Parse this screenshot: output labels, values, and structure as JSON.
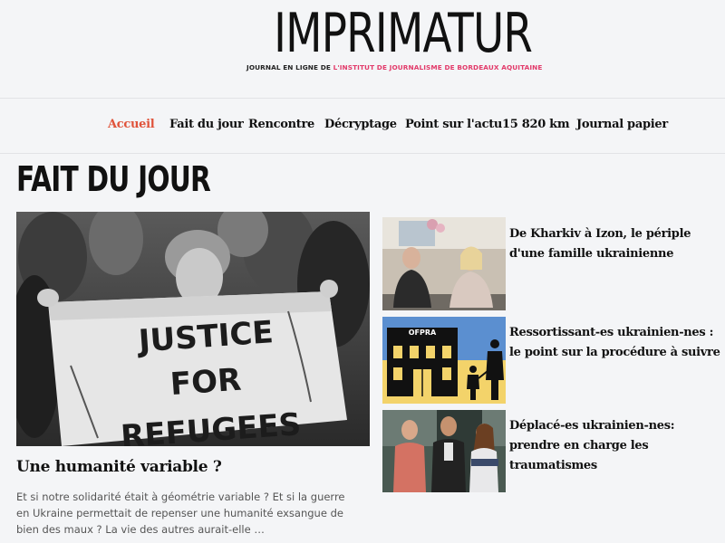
{
  "masthead": {
    "title": "IMPRIMATUR",
    "subtitle_prefix": "JOURNAL EN LIGNE DE ",
    "subtitle_highlight": "L'INSTITUT DE JOURNALISME DE BORDEAUX AQUITAINE"
  },
  "nav": {
    "items": [
      {
        "label": "Accueil",
        "active": true
      },
      {
        "label": "Fait du jour"
      },
      {
        "label": "Rencontre"
      },
      {
        "label": "Décryptage"
      },
      {
        "label": "Point sur l'actu"
      },
      {
        "label": "15 820 km"
      },
      {
        "label": "Journal papier"
      }
    ]
  },
  "section": {
    "title": "FAIT DU JOUR"
  },
  "main_article": {
    "image_text": [
      "JUSTICE",
      "FOR",
      "REFUGEES"
    ],
    "title": "Une humanité variable ?",
    "excerpt": "Et si notre solidarité était à géométrie variable ? Et si la guerre en Ukraine permettait de repenser une humanité exsangue de bien des maux ? La vie des autres aurait-elle …"
  },
  "side_articles": [
    {
      "title": "De Kharkiv à Izon, le périple d'une famille ukrainienne"
    },
    {
      "title": "Ressortissant-es ukrainien-nes : le point sur la procédure à suivre",
      "image_label": "OFPRA"
    },
    {
      "title": "Déplacé-es ukrainien-nes: prendre en charge les traumatismes"
    }
  ],
  "colors": {
    "accent": "#e0533a",
    "brand_pink": "#e23a6a",
    "ukraine_blue": "#5b8fd0",
    "ukraine_yellow": "#f3d36a"
  }
}
